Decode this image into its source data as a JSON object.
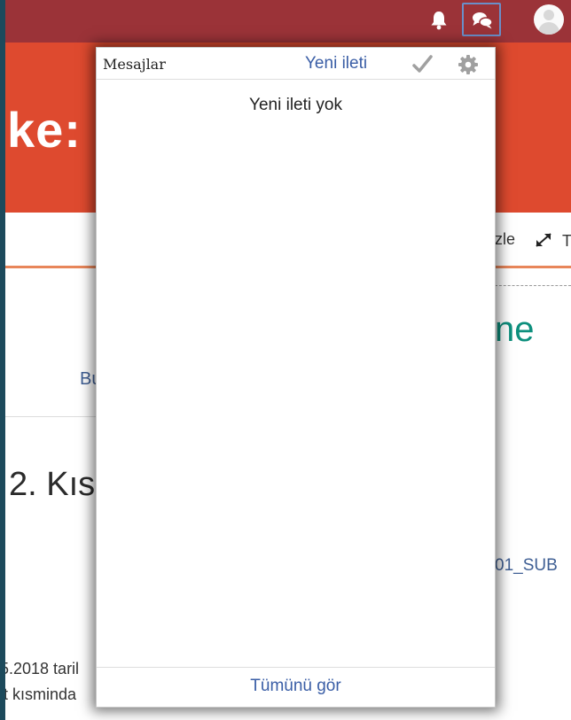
{
  "navbar": {
    "bell_icon": "bell-icon",
    "messages_icon": "chat-bubbles-icon",
    "avatar_icon": "user-avatar-icon"
  },
  "banner": {
    "logo_partial": "ke:"
  },
  "background_page": {
    "nav_partial": "izle",
    "nav_trailing": "T",
    "course_title_partial": "ne",
    "link_partial": "Bu",
    "section_title_partial": "2. Kıs",
    "file_link_partial": "01_SUB",
    "paragraph_line1_partial": "5.2018 taril",
    "paragraph_line2_partial": "t kısminda"
  },
  "messages_popover": {
    "title": "Mesajlar",
    "new_message_link": "Yeni ileti",
    "mark_read_icon": "checkmark-icon",
    "settings_icon": "gear-icon",
    "empty_text": "Yeni ileti yok",
    "see_all_link": "Tümünü gör"
  },
  "colors": {
    "navbar": "#9b3338",
    "banner": "#de4a2f",
    "link": "#3a5ea6",
    "course_title": "#0d8f7d",
    "active_outline": "#6a8fc9"
  }
}
